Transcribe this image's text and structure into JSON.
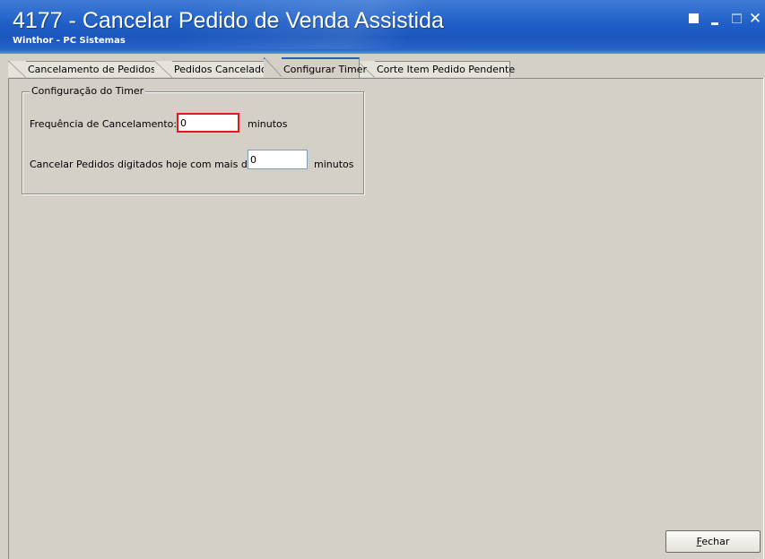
{
  "window": {
    "title": "4177 - Cancelar Pedido de Venda Assistida",
    "subtitle": "Winthor - PC Sistemas",
    "controls": {
      "restore_icon": "restore-icon",
      "minimize_icon": "minimize-icon",
      "maximize_icon": "maximize-icon",
      "close_glyph": "✕"
    }
  },
  "tabs": [
    {
      "label": "Cancelamento de Pedidos",
      "active": false
    },
    {
      "label": "Pedidos Cancelados",
      "active": false
    },
    {
      "label": "Configurar Timer",
      "active": true
    },
    {
      "label": "Corte Item Pedido Pendente",
      "active": false
    }
  ],
  "timer_config": {
    "group_title": "Configuração do Timer",
    "frequency_label": "Frequência de Cancelamento:",
    "frequency_value": "0",
    "frequency_unit": "minutos",
    "older_than_label": "Cancelar Pedidos digitados hoje com mais de",
    "older_than_value": "0",
    "older_than_unit": "minutos"
  },
  "footer": {
    "close_button_label_underlined": "F",
    "close_button_label_rest": "echar"
  },
  "colors": {
    "titlebar": "#1f5fc7",
    "focus_border": "#e01a1a",
    "background": "#d4d0c8"
  }
}
